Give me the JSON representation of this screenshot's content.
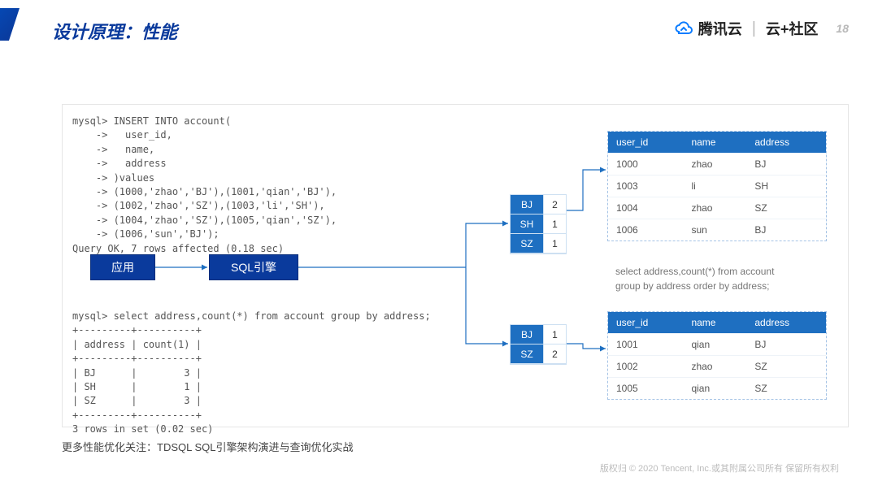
{
  "header": {
    "title": "设计原理：性能",
    "brand_cloud": "腾讯云",
    "brand_community": "云+社区",
    "page_number": "18"
  },
  "code_block_1": "mysql> INSERT INTO account(\n    ->   user_id,\n    ->   name,\n    ->   address\n    -> )values\n    -> (1000,'zhao','BJ'),(1001,'qian','BJ'),\n    -> (1002,'zhao','SZ'),(1003,'li','SH'),\n    -> (1004,'zhao','SZ'),(1005,'qian','SZ'),\n    -> (1006,'sun','BJ');\nQuery OK, 7 rows affected (0.18 sec)",
  "code_block_2": "mysql> select address,count(*) from account group by address;\n+---------+----------+\n| address | count(1) |\n+---------+----------+\n| BJ      |        3 |\n| SH      |        1 |\n| SZ      |        3 |\n+---------+----------+\n3 rows in set (0.02 sec)",
  "flow": {
    "app": "应用",
    "engine": "SQL引擎"
  },
  "mini_table_top": [
    {
      "addr": "BJ",
      "cnt": "2"
    },
    {
      "addr": "SH",
      "cnt": "1"
    },
    {
      "addr": "SZ",
      "cnt": "1"
    }
  ],
  "mini_table_bottom": [
    {
      "addr": "BJ",
      "cnt": "1"
    },
    {
      "addr": "SZ",
      "cnt": "2"
    }
  ],
  "table_headers": {
    "user_id": "user_id",
    "name": "name",
    "address": "address"
  },
  "table_top": [
    {
      "user_id": "1000",
      "name": "zhao",
      "address": "BJ"
    },
    {
      "user_id": "1003",
      "name": "li",
      "address": "SH"
    },
    {
      "user_id": "1004",
      "name": "zhao",
      "address": "SZ"
    },
    {
      "user_id": "1006",
      "name": "sun",
      "address": "BJ"
    }
  ],
  "table_bottom": [
    {
      "user_id": "1001",
      "name": "qian",
      "address": "BJ"
    },
    {
      "user_id": "1002",
      "name": "zhao",
      "address": "SZ"
    },
    {
      "user_id": "1005",
      "name": "qian",
      "address": "SZ"
    }
  ],
  "sql_note": "select address,count(*) from account\ngroup by address order by address;",
  "bottom_note": "更多性能优化关注：TDSQL SQL引擎架构演进与查询优化实战",
  "copyright": "版权归 © 2020 Tencent, Inc.或其附属公司所有 保留所有权利"
}
